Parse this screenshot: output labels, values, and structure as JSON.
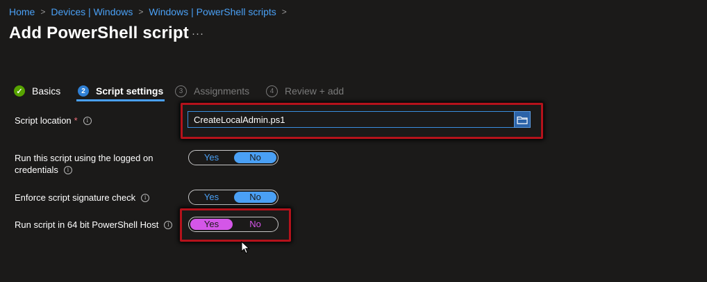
{
  "breadcrumb": {
    "items": [
      "Home",
      "Devices | Windows",
      "Windows | PowerShell scripts"
    ],
    "separator": ">"
  },
  "page": {
    "title": "Add PowerShell script",
    "more": "···"
  },
  "tabs": [
    {
      "label": "Basics",
      "marker": "✓",
      "state": "complete"
    },
    {
      "label": "Script settings",
      "marker": "2",
      "state": "active"
    },
    {
      "label": "Assignments",
      "marker": "3",
      "state": "disabled"
    },
    {
      "label": "Review + add",
      "marker": "4",
      "state": "disabled"
    }
  ],
  "form": {
    "script_location": {
      "label": "Script location",
      "required_mark": "*",
      "info": "i",
      "value": "CreateLocalAdmin.ps1",
      "browse_icon": "folder-icon"
    },
    "run_logged_on": {
      "label_line1": "Run this script using the logged on",
      "label_line2": "credentials",
      "info": "i",
      "yes": "Yes",
      "no": "No",
      "selected": "No"
    },
    "signature_check": {
      "label": "Enforce script signature check",
      "info": "i",
      "yes": "Yes",
      "no": "No",
      "selected": "No"
    },
    "run_64bit": {
      "label": "Run script in 64 bit PowerShell Host",
      "info": "i",
      "yes": "Yes",
      "no": "No",
      "selected": "Yes"
    }
  },
  "colors": {
    "background": "#1b1a19",
    "link": "#4aa0f5",
    "toggle_active": "#4aa0f5",
    "toggle_highlight": "#d456e8",
    "highlight_box": "#b5121b",
    "complete": "#57a300"
  }
}
